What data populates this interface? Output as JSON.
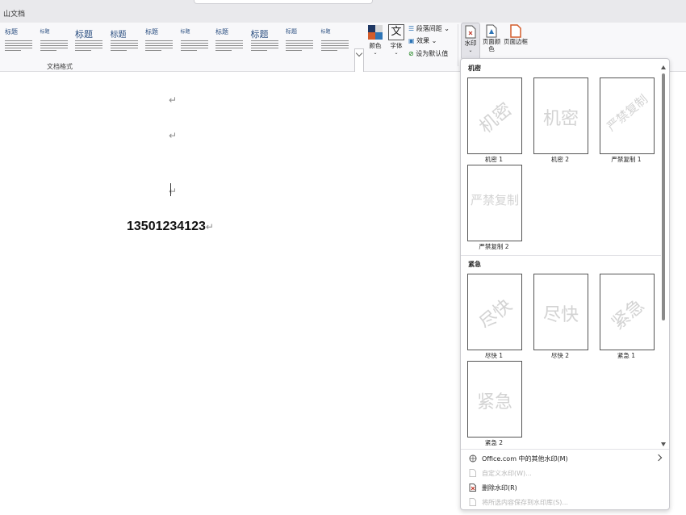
{
  "app": {
    "title": "山文档"
  },
  "ribbon": {
    "styles": [
      {
        "heading": "标题",
        "size": 8
      },
      {
        "heading": "标题",
        "size": 6
      },
      {
        "heading": "标题",
        "size": 11
      },
      {
        "heading": "标题",
        "size": 10
      },
      {
        "heading": "标题",
        "size": 8
      },
      {
        "heading": "标题",
        "size": 6
      },
      {
        "heading": "标题",
        "size": 8
      },
      {
        "heading": "标题",
        "size": 11
      },
      {
        "heading": "标题",
        "size": 7
      },
      {
        "heading": "标题",
        "size": 6
      }
    ],
    "styles_group_label": "文档格式",
    "colors_label": "颜色",
    "fonts_label": "字体",
    "paragraph_spacing_label": "段落间距",
    "effects_label": "效果",
    "set_default_label": "设为默认值",
    "watermark_label": "水印",
    "page_color_label": "页面颜色",
    "page_border_label": "页面边框"
  },
  "document": {
    "phone": "13501234123",
    "paragraph_mark": "↵"
  },
  "watermark_panel": {
    "sections": [
      {
        "title": "机密",
        "items": [
          {
            "text": "机密",
            "caption": "机密 1",
            "style": "diag"
          },
          {
            "text": "机密",
            "caption": "机密 2",
            "style": "horiz"
          },
          {
            "text": "严禁复制",
            "caption": "严禁复制 1",
            "style": "diag"
          },
          {
            "text": "严禁复制",
            "caption": "严禁复制 2",
            "style": "horiz"
          }
        ]
      },
      {
        "title": "紧急",
        "items": [
          {
            "text": "尽快",
            "caption": "尽快 1",
            "style": "diag"
          },
          {
            "text": "尽快",
            "caption": "尽快 2",
            "style": "horiz"
          },
          {
            "text": "紧急",
            "caption": "紧急 1",
            "style": "diag"
          },
          {
            "text": "紧急",
            "caption": "紧急 2",
            "style": "horiz"
          }
        ]
      }
    ],
    "menu": [
      {
        "label": "Office.com 中的其他水印(M)",
        "icon": "globe-icon",
        "enabled": true,
        "submenu": true
      },
      {
        "label": "自定义水印(W)...",
        "icon": "doc-icon",
        "enabled": false,
        "submenu": false
      },
      {
        "label": "删除水印(R)",
        "icon": "remove-watermark-icon",
        "enabled": true,
        "submenu": false
      },
      {
        "label": "将所选内容保存到水印库(S)...",
        "icon": "save-icon",
        "enabled": false,
        "submenu": false
      }
    ]
  },
  "colors": {
    "heading": "#2b4f81",
    "accent_orange": "#d35c2b",
    "accent_navy": "#1f3864",
    "watermark_gray": "#d3d3d3",
    "remove_red": "#c0392b"
  }
}
